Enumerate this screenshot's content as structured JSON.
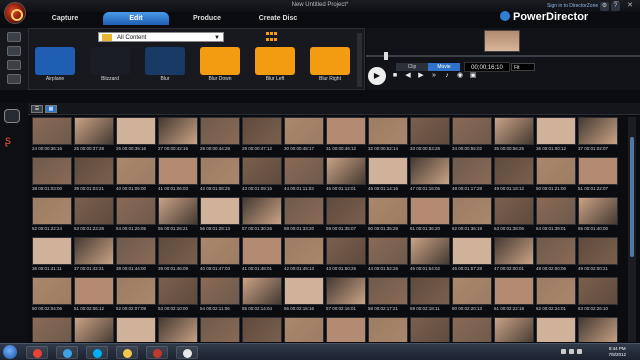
{
  "window": {
    "title": "New Untitled Project*",
    "controls": [
      "–",
      "❐",
      "✕"
    ]
  },
  "modes": {
    "tabs": [
      {
        "label": "Capture",
        "active": false
      },
      {
        "label": "Edit",
        "active": true
      },
      {
        "label": "Produce",
        "active": false
      },
      {
        "label": "Create Disc",
        "active": false
      }
    ]
  },
  "brand": {
    "name": "PowerDirector",
    "signin": "Sign in to DirectorZone"
  },
  "library": {
    "filter_value": "All Content",
    "effects": [
      {
        "label": "Airplane",
        "color": "#1f5eb2"
      },
      {
        "label": "Blizzard",
        "color": "#1a1d24"
      },
      {
        "label": "Blur",
        "color": "#1a3a66"
      },
      {
        "label": "Blur Down",
        "color": "#f39c12"
      },
      {
        "label": "Blur Left",
        "color": "#f39c12"
      },
      {
        "label": "Blur Right",
        "color": "#f39c12"
      }
    ]
  },
  "preview": {
    "tab_clip": "Clip",
    "tab_movie": "Movie",
    "timecode": "00;00;16;10",
    "fit": "Fit"
  },
  "media": {
    "clips": [
      [
        "24",
        "00:00:36:16"
      ],
      [
        "25",
        "00:00:37:28"
      ],
      [
        "26",
        "00:00:39:16"
      ],
      [
        "27",
        "00:00:42:16"
      ],
      [
        "28",
        "00:00:44:28"
      ],
      [
        "29",
        "00:00:47:12"
      ],
      [
        "30",
        "00:00:48:17"
      ],
      [
        "31",
        "00:00:49:12"
      ],
      [
        "32",
        "00:00:52:14"
      ],
      [
        "33",
        "00:00:53:28"
      ],
      [
        "34",
        "00:00:55:02"
      ],
      [
        "35",
        "00:00:56:25"
      ],
      [
        "36",
        "00:01:00:12"
      ],
      [
        "37",
        "00:01:02:07"
      ],
      [
        "38",
        "00:01:03:00"
      ],
      [
        "39",
        "00:01:03:21"
      ],
      [
        "40",
        "00:01:05:00"
      ],
      [
        "41",
        "00:01:06:03"
      ],
      [
        "42",
        "00:01:08:25"
      ],
      [
        "43",
        "00:01:09:15"
      ],
      [
        "44",
        "00:01:11:03"
      ],
      [
        "45",
        "00:01:12:01"
      ],
      [
        "46",
        "00:01:14:16"
      ],
      [
        "47",
        "00:01:16:05"
      ],
      [
        "48",
        "00:01:17:28"
      ],
      [
        "49",
        "00:01:19:12"
      ],
      [
        "50",
        "00:01:21:00"
      ],
      [
        "51",
        "00:01:22:07"
      ],
      [
        "52",
        "00:01:22:24"
      ],
      [
        "53",
        "00:01:23:28"
      ],
      [
        "54",
        "00:01:25:05"
      ],
      [
        "55",
        "00:01:26:21"
      ],
      [
        "56",
        "00:01:28:13"
      ],
      [
        "57",
        "00:01:30:26"
      ],
      [
        "58",
        "00:01:33:20"
      ],
      [
        "59",
        "00:01:35:07"
      ],
      [
        "60",
        "00:01:35:28"
      ],
      [
        "61",
        "00:01:36:20"
      ],
      [
        "62",
        "00:01:36:19"
      ],
      [
        "63",
        "00:01:38:06"
      ],
      [
        "64",
        "00:01:39:01"
      ],
      [
        "65",
        "00:01:40:00"
      ],
      [
        "36",
        "00:01:41:11"
      ],
      [
        "37",
        "00:01:42:21"
      ],
      [
        "38",
        "00:01:44:00"
      ],
      [
        "39",
        "00:01:46:09"
      ],
      [
        "40",
        "00:01:47:03"
      ],
      [
        "41",
        "00:01:48:01"
      ],
      [
        "42",
        "00:01:49:13"
      ],
      [
        "43",
        "00:01:50:26"
      ],
      [
        "44",
        "00:01:52:26"
      ],
      [
        "45",
        "00:01:54:02"
      ],
      [
        "46",
        "00:01:57:28"
      ],
      [
        "47",
        "00:02:00:01"
      ],
      [
        "48",
        "00:02:00:06"
      ],
      [
        "49",
        "00:02:00:21"
      ],
      [
        "50",
        "00:02:04:06"
      ],
      [
        "51",
        "00:02:06:12"
      ],
      [
        "52",
        "00:02:07:09"
      ],
      [
        "53",
        "00:02:10:00"
      ],
      [
        "54",
        "00:02:11:06"
      ],
      [
        "55",
        "00:02:14:04"
      ],
      [
        "56",
        "00:02:15:16"
      ],
      [
        "57",
        "00:02:16:01"
      ],
      [
        "58",
        "00:02:17:21"
      ],
      [
        "59",
        "00:02:18:11"
      ],
      [
        "60",
        "00:02:20:13"
      ],
      [
        "61",
        "00:02:22:18"
      ],
      [
        "62",
        "00:02:24:01"
      ],
      [
        "63",
        "00:02:26:10"
      ],
      [
        "64",
        "00:02:27:02"
      ],
      [
        "65",
        "00:02:28:12"
      ],
      [
        "66",
        "00:02:30:00"
      ],
      [
        "67",
        "00:02:31:17"
      ],
      [
        "68",
        "00:02:33:05"
      ],
      [
        "69",
        "00:02:34:20"
      ],
      [
        "70",
        "00:02:36:11"
      ],
      [
        "71",
        "00:02:38:00"
      ],
      [
        "72",
        "00:02:39:18"
      ],
      [
        "73",
        "00:02:41:06"
      ],
      [
        "74",
        "00:02:42:25"
      ],
      [
        "75",
        "00:02:44:13"
      ],
      [
        "76",
        "00:02:46:02"
      ],
      [
        "77",
        "00:02:47:20"
      ]
    ],
    "thumb_colors": [
      "#8a6a55",
      "#b38b72",
      "#6e5a4c",
      "#c9a386",
      "#9c7c63",
      "#5f4a3d",
      "#d0b29a",
      "#7a604d",
      "#a9876c",
      "#463a32"
    ]
  },
  "taskbar": {
    "time": "8:44 PM",
    "date": "7/8/2012",
    "apps": [
      {
        "name": "chrome-taskbar-icon",
        "color": "#e94335"
      },
      {
        "name": "media-player-taskbar-icon",
        "color": "#3ba3e6"
      },
      {
        "name": "skype-taskbar-icon",
        "color": "#00aff0"
      },
      {
        "name": "explorer-taskbar-icon",
        "color": "#f2c94c"
      },
      {
        "name": "powerdirector-taskbar-icon",
        "color": "#c0392b"
      },
      {
        "name": "playback-taskbar-icon",
        "color": "#e8e8e8"
      }
    ]
  }
}
